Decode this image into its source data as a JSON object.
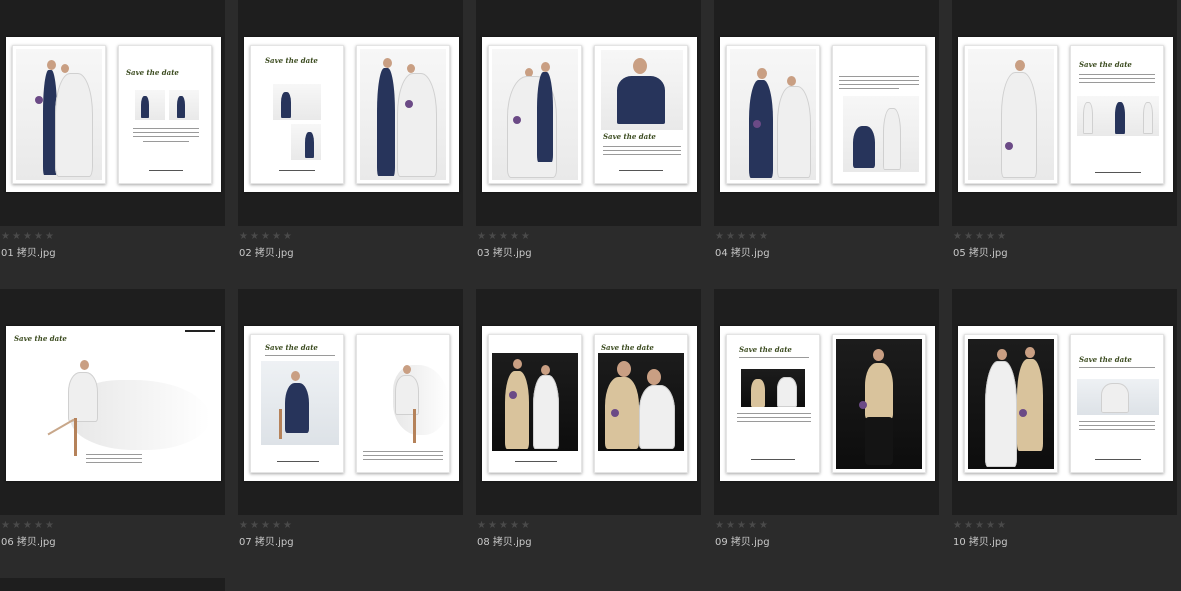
{
  "thumbnails": [
    {
      "filename": "01 拷贝.jpg",
      "rating": 0
    },
    {
      "filename": "02 拷贝.jpg",
      "rating": 0
    },
    {
      "filename": "03 拷贝.jpg",
      "rating": 0
    },
    {
      "filename": "04 拷贝.jpg",
      "rating": 0
    },
    {
      "filename": "05 拷贝.jpg",
      "rating": 0
    },
    {
      "filename": "06 拷贝.jpg",
      "rating": 0
    },
    {
      "filename": "07 拷贝.jpg",
      "rating": 0
    },
    {
      "filename": "08 拷贝.jpg",
      "rating": 0
    },
    {
      "filename": "09 拷贝.jpg",
      "rating": 0
    },
    {
      "filename": "10 拷贝.jpg",
      "rating": 0
    }
  ],
  "spread_text": {
    "headline": "Save the date"
  },
  "colors": {
    "background": "#2b2b2b",
    "cell": "#1e1e1e",
    "star_empty": "#4a4a4a",
    "filename_text": "#c8c8c8"
  }
}
